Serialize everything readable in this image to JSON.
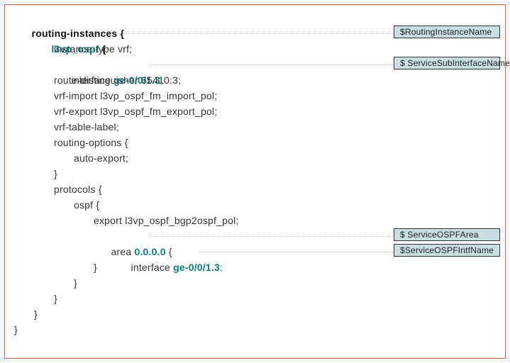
{
  "code": {
    "l0": "routing-instances {",
    "l1_name": "l3vp_ospf",
    "l1_rest": " {",
    "l2": "instance-type vrf;",
    "l3_a": "interface ",
    "l3_b": "ge-0/0/1.3",
    "l3_c": ";",
    "l4": "route-distinguisher 65410:3;",
    "l5": "vrf-import l3vp_ospf_fm_import_pol;",
    "l6": "vrf-export l3vp_ospf_fm_export_pol;",
    "l7": "vrf-table-label;",
    "l8": "routing-options {",
    "l9": "auto-export;",
    "l10": "}",
    "l11": "protocols {",
    "l12": "ospf {",
    "l13": "export l3vp_ospf_bgp2ospf_pol;",
    "l14_a": "area ",
    "l14_b": "0.0.0.0",
    "l14_c": " {",
    "l15_a": "interface ",
    "l15_b": "ge-0/0/1.3",
    "l15_c": ";",
    "l16": "}",
    "l17": "}",
    "l18": "}",
    "l19": "}",
    "l20": "}"
  },
  "labels": {
    "routing_instance_name": "$RoutingInstanceName",
    "service_sub_interface_name": "$ ServiceSubInterfaceName",
    "service_ospf_area": "$ ServiceOSPFArea",
    "service_ospf_intf_name": "$ServiceOSPFIntfName"
  }
}
